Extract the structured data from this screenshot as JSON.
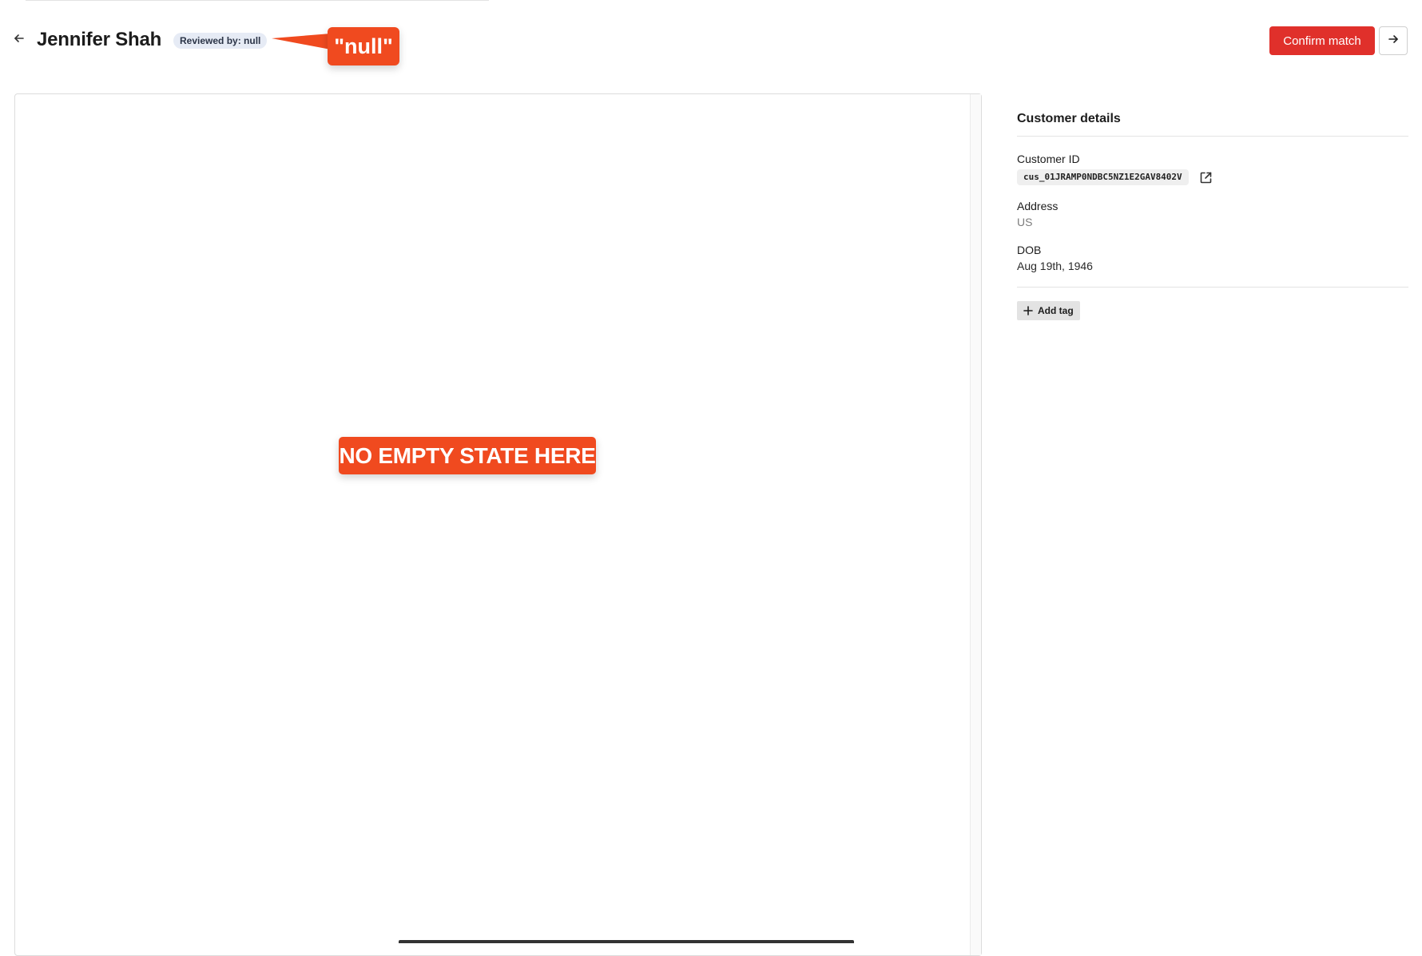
{
  "header": {
    "title": "Jennifer Shah",
    "reviewed_badge": "Reviewed by: null",
    "confirm_label": "Confirm match",
    "back_icon": "arrow-left-icon",
    "next_icon": "arrow-right-icon"
  },
  "annotations": {
    "null_callout": "\"null\"",
    "empty_state_callout": "NO EMPTY STATE HERE"
  },
  "details": {
    "title": "Customer details",
    "customer_id_label": "Customer ID",
    "customer_id_value": "cus_01JRAMP0NDBC5NZ1E2GAV8402V",
    "address_label": "Address",
    "address_value": "US",
    "dob_label": "DOB",
    "dob_value": "Aug 19th, 1946",
    "add_tag_label": "Add tag",
    "external_link_icon": "external-link-icon",
    "plus_icon": "plus-icon"
  },
  "colors": {
    "accent_red": "#e0302b",
    "callout_orange": "#f04a1f",
    "badge_bg": "#e6ebf5"
  }
}
